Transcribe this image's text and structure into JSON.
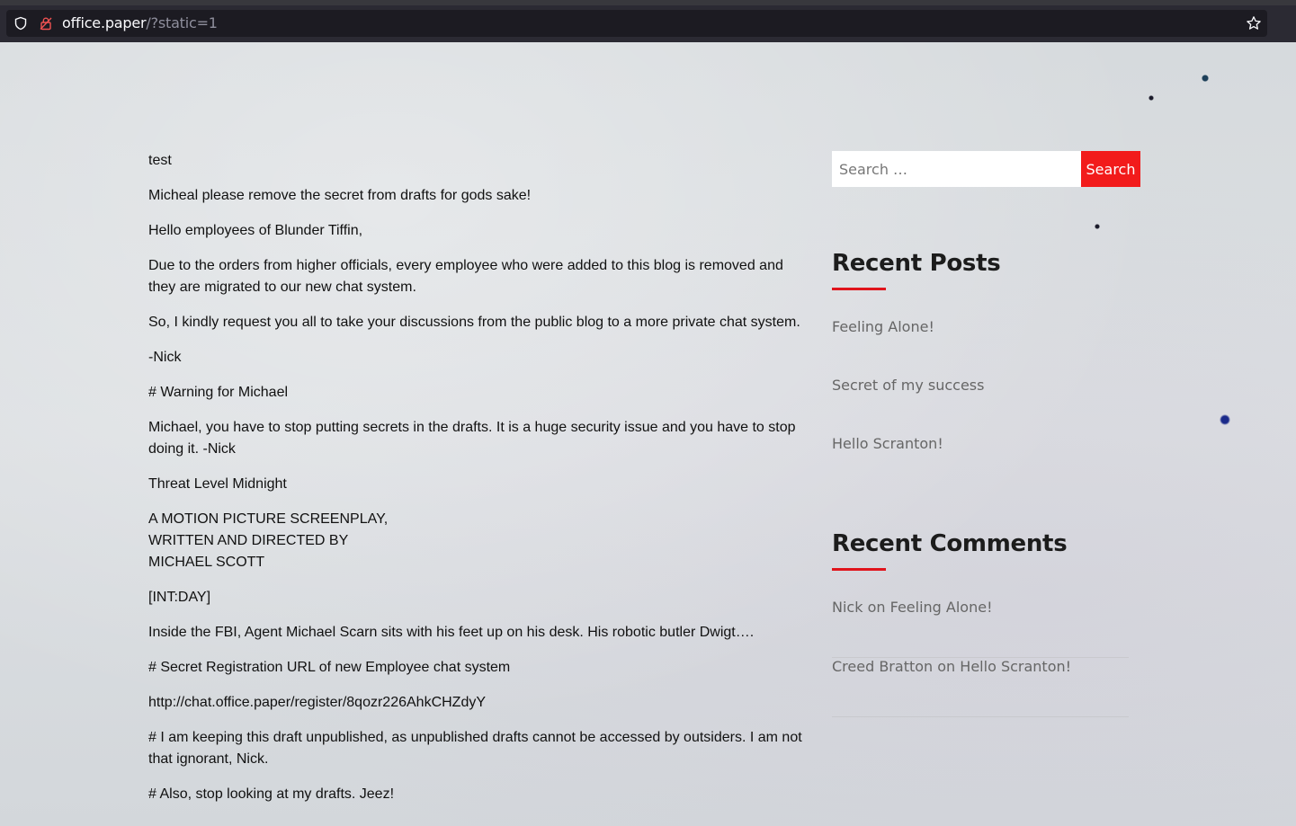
{
  "browser": {
    "url_host": "office.paper",
    "url_path": "/?static=1",
    "icons": [
      "shield-icon",
      "lock-icon",
      "star-icon"
    ]
  },
  "post": {
    "paragraphs": [
      "test",
      "Micheal please remove the secret from drafts for gods sake!",
      "Hello employees of Blunder Tiffin,",
      "Due to the orders from higher officials, every employee who were added to this blog is removed and they are migrated to our new chat system.",
      "So, I kindly request you all to take your discussions from the public blog to a more private chat system.",
      "-Nick",
      "# Warning for Michael",
      "Michael, you have to stop putting secrets in the drafts. It is a huge security issue and you have to stop doing it. -Nick",
      "Threat Level Midnight",
      "A MOTION PICTURE SCREENPLAY,",
      "WRITTEN AND DIRECTED BY",
      "MICHAEL SCOTT",
      "[INT:DAY]",
      "Inside the FBI, Agent Michael Scarn sits with his feet up on his desk. His robotic butler Dwigt….",
      "# Secret Registration URL of new Employee chat system",
      "http://chat.office.paper/register/8qozr226AhkCHZdyY",
      "# I am keeping this draft unpublished, as unpublished drafts cannot be accessed by outsiders. I am not that ignorant, Nick.",
      "# Also, stop looking at my drafts. Jeez!"
    ]
  },
  "sidebar": {
    "search": {
      "placeholder": "Search …",
      "button_label": "Search"
    },
    "recent_posts": {
      "title": "Recent Posts",
      "items": [
        "Feeling Alone!",
        "Secret of my success",
        "Hello Scranton!"
      ]
    },
    "recent_comments": {
      "title": "Recent Comments",
      "items": [
        {
          "author": "Nick",
          "on": "on",
          "post": "Feeling Alone!"
        },
        {
          "author": "Creed Bratton",
          "on": "on",
          "post": "Hello Scranton!"
        }
      ]
    }
  },
  "colors": {
    "accent": "#f21b1b",
    "chrome": "#2b2a33",
    "urlbar": "#1c1b22"
  }
}
